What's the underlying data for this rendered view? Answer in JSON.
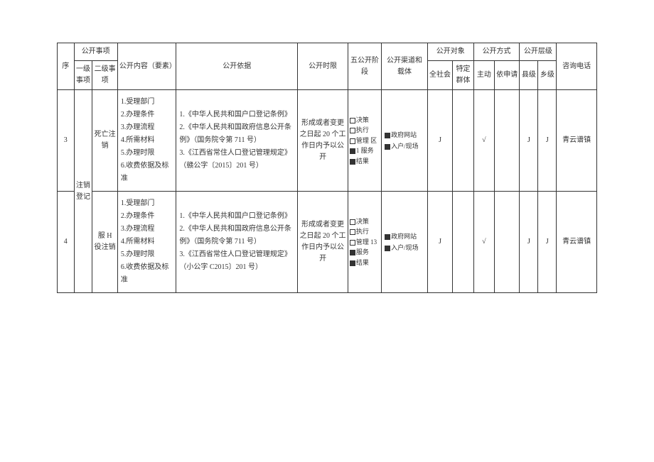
{
  "headers": {
    "seq": "序",
    "item": "公开事项",
    "level1": "一级事项",
    "level2": "二级事项",
    "content": "公开内容（要素）",
    "basis": "公开依据",
    "timeLimit": "公开时限",
    "stage": "五公开阶段",
    "channel": "公开渠道和载体",
    "target": "公开对象",
    "allSociety": "全社会",
    "specificGroup": "特定群体",
    "method": "公开方式",
    "active": "主动",
    "onRequest": "依申请",
    "level": "公开层级",
    "county": "县级",
    "township": "乡级",
    "phone": "咨询电话"
  },
  "level1_value": "注销登记",
  "rows": [
    {
      "seq": "3",
      "level2": "死亡注销",
      "content": [
        "1.受理部门",
        "2.办理条件",
        "3.办理流程",
        "4.所需材料",
        "5.办理时限",
        "6.收费依据及标准"
      ],
      "basis": [
        "1.《中华人民共和国户口登记条例》",
        "2.《中华人民共和国政府信息公开条例》（国务院令第 711 号）",
        "3.《江西省常住人口登记管理规定》（赣公字〔2015〕201 号）"
      ],
      "timeLimit": "形成或者变更之日起 20 个工作日内予以公开",
      "stage": [
        {
          "label": "决策",
          "checked": false
        },
        {
          "label": "执行",
          "checked": false
        },
        {
          "label": "管理 区",
          "checked": false
        },
        {
          "label": "1 服务",
          "checked": true
        },
        {
          "label": "结果",
          "checked": true
        }
      ],
      "carriers": [
        {
          "label": "政府网站",
          "checked": true
        },
        {
          "label": "入户/现场",
          "checked": true
        }
      ],
      "allSociety": "J",
      "specificGroup": "",
      "active": "√",
      "onRequest": "",
      "county": "J",
      "township": "J",
      "phone": "青云谱镇"
    },
    {
      "seq": "4",
      "level2": "服 H 役注销",
      "content": [
        "1.受理部门",
        "2.办理条件",
        "3.办理流程",
        "4.所需材料",
        "5.办理时限",
        "6.收费依据及标准"
      ],
      "basis": [
        "1.《中华人民共和国户口登记条例》",
        "2.《中华人民共和国政府信息公开条例》（国务院令第 711 号）",
        "3.《江西省常住人口登记管理规定》（小公字 C2015〕201 号）"
      ],
      "timeLimit": "形成或者变更之日起 20 个工作日内予以公开",
      "stage": [
        {
          "label": "决策",
          "checked": false
        },
        {
          "label": "执行",
          "checked": false
        },
        {
          "label": "管理 13",
          "checked": false
        },
        {
          "label": "服务",
          "checked": true
        },
        {
          "label": "结果",
          "checked": true
        }
      ],
      "carriers": [
        {
          "label": "政府网站",
          "checked": true
        },
        {
          "label": "入户/现场",
          "checked": true
        }
      ],
      "allSociety": "J",
      "specificGroup": "",
      "active": "√",
      "onRequest": "",
      "county": "J",
      "township": "J",
      "phone": "青云谱镇"
    }
  ]
}
